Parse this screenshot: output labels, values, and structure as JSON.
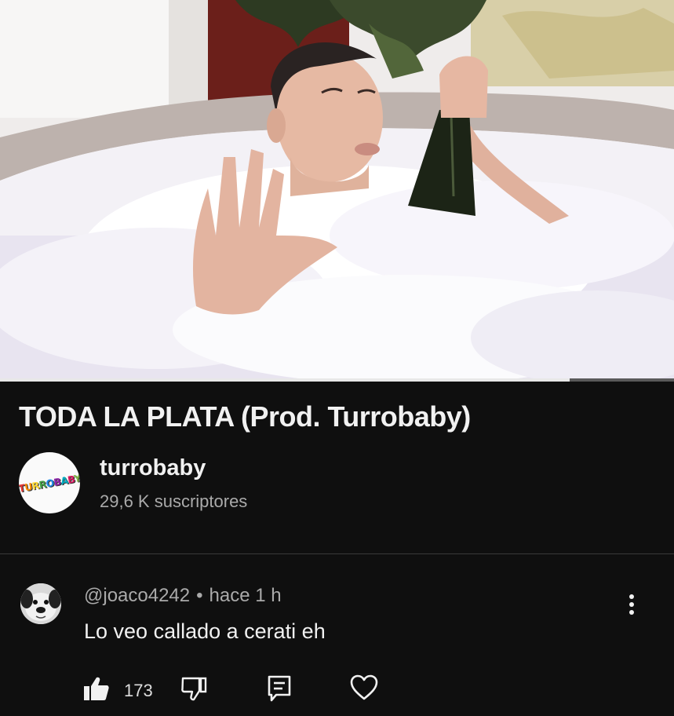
{
  "video": {
    "title": "TODA LA PLATA (Prod. Turrobaby)",
    "progress_fraction": 0.845
  },
  "channel": {
    "name": "turrobaby",
    "subscribers": "29,6 K suscriptores",
    "logo_text": "TURROBABY"
  },
  "comment": {
    "author": "@joaco4242",
    "separator": "•",
    "time": "hace 1 h",
    "text": "Lo veo callado a cerati eh",
    "likes": "173"
  },
  "icons": {
    "more": "more-vert-icon",
    "like": "thumbs-up-icon",
    "dislike": "thumbs-down-icon",
    "reply": "reply-comment-icon",
    "heart": "heart-icon"
  },
  "colors": {
    "background": "#0f0f0f",
    "text_primary": "#f1f1f1",
    "text_secondary": "#aaaaaa"
  }
}
